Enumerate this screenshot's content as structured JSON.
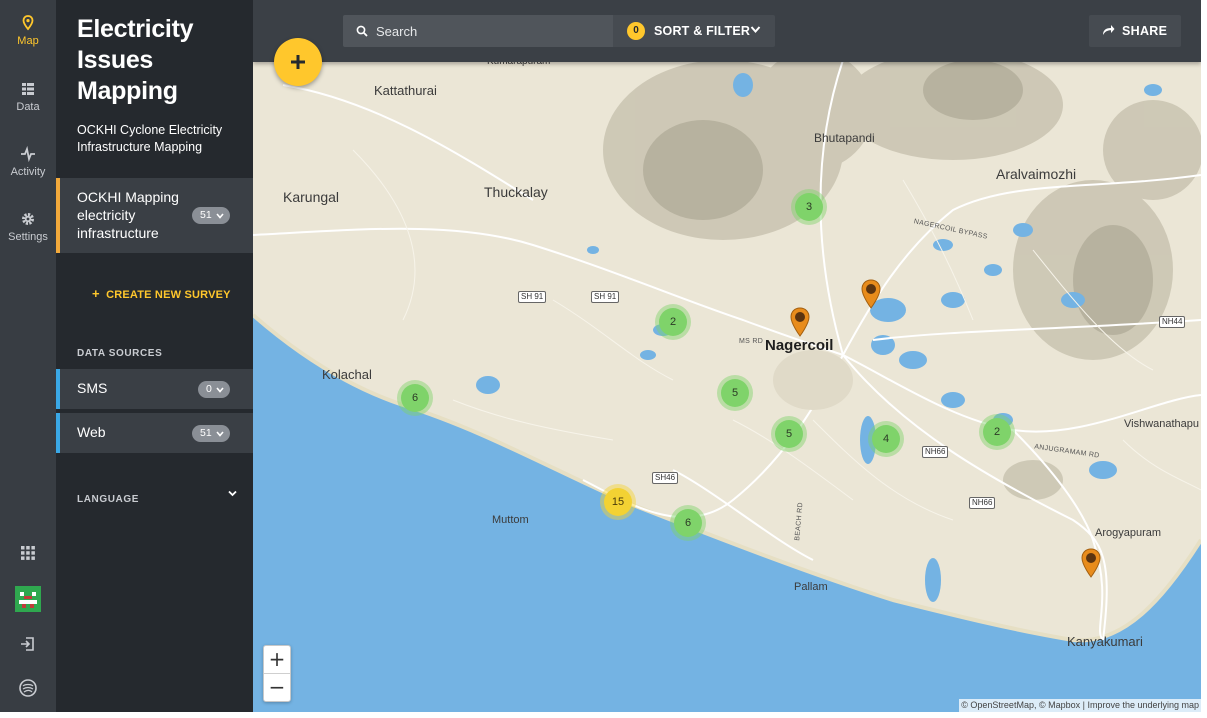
{
  "rail": {
    "map_label": "Map",
    "data_label": "Data",
    "activity_label": "Activity",
    "settings_label": "Settings",
    "accent": "#ffc72c"
  },
  "sidebar": {
    "title": "Electricity Issues Mapping",
    "description": "OCKHI Cyclone Electricity Infrastructure Mapping",
    "survey": {
      "label": "OCKHI Mapping electricity infrastructure",
      "count": "51"
    },
    "create_survey_label": "CREATE NEW SURVEY",
    "data_sources_heading": "DATA SOURCES",
    "data_sources": [
      {
        "label": "SMS",
        "count": "0"
      },
      {
        "label": "Web",
        "count": "51"
      }
    ],
    "language_label": "LANGUAGE"
  },
  "toolbar": {
    "search_placeholder": "Search",
    "filter_count": "0",
    "filter_label": "SORT & FILTER",
    "share_label": "SHARE"
  },
  "map": {
    "zoom_in": "+",
    "zoom_out": "−",
    "attribution": "© OpenStreetMap, © Mapbox | Improve the underlying map",
    "places": {
      "kattathurai": "Kattathurai",
      "bhutapandi": "Bhutapandi",
      "aralvaimozhi": "Aralvaimozhi",
      "karungal": "Karungal",
      "thuckalay": "Thuckalay",
      "nagercoil": "Nagercoil",
      "kolachal": "Kolachal",
      "muttom": "Muttom",
      "pallam": "Pallam",
      "arogyapuram": "Arogyapuram",
      "kanyakumari": "Kanyakumari",
      "vishwanathapu": "Vishwanathapu",
      "kumarapuram": "Kumarapuram"
    },
    "road_signs": {
      "sh91a": "SH 91",
      "sh91b": "SH 91",
      "nh44": "NH44",
      "sh46": "SH46",
      "nh66a": "NH66",
      "nh66b": "NH66"
    },
    "road_labels": {
      "nagercoil_bypass": "NAGERCOIL BYPASS",
      "ms_rd": "MS RD",
      "anjugramam_rd": "ANJUGRAMAM RD",
      "beach_rd": "BEACH RD"
    },
    "clusters": [
      {
        "count": "3",
        "color": "green"
      },
      {
        "count": "2",
        "color": "green"
      },
      {
        "count": "6",
        "color": "green"
      },
      {
        "count": "5",
        "color": "green"
      },
      {
        "count": "5",
        "color": "green"
      },
      {
        "count": "4",
        "color": "green"
      },
      {
        "count": "2",
        "color": "green"
      },
      {
        "count": "15",
        "color": "yellow"
      },
      {
        "count": "6",
        "color": "green"
      }
    ]
  }
}
